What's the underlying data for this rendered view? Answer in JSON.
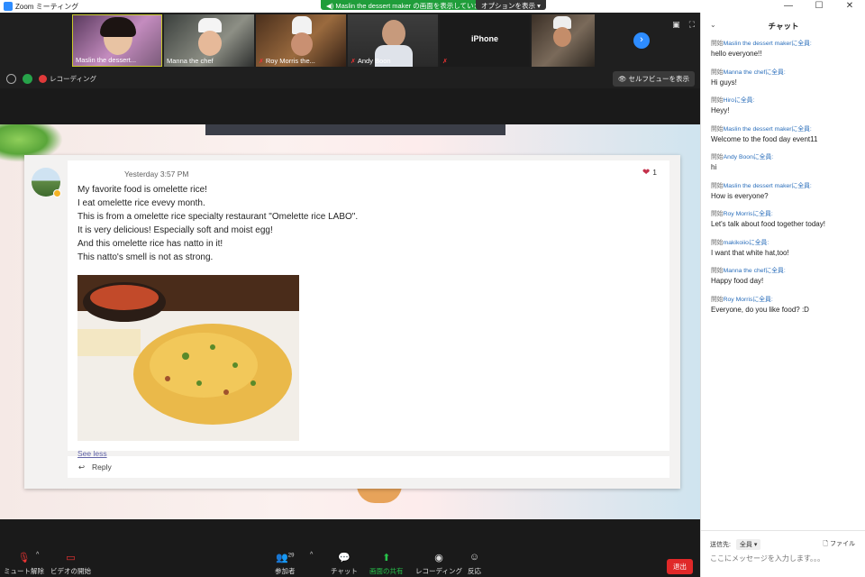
{
  "window": {
    "title": "Zoom ミーティング",
    "share_banner": "Maslin the dessert maker の画面を表示しています",
    "options_button": "オプションを表示 ▾",
    "controls": [
      "—",
      "☐",
      "✕"
    ]
  },
  "participants": [
    {
      "name": "Maslin the dessert..."
    },
    {
      "name": "Manna the chef"
    },
    {
      "name": "Roy Morris the..."
    },
    {
      "name": "Andy Boon"
    },
    {
      "name": "",
      "label": "iPhone"
    },
    {
      "name": ""
    }
  ],
  "status": {
    "recording_label": "レコーディング",
    "self_view_button": "セルフビューを表示"
  },
  "post": {
    "timestamp": "Yesterday 3:57 PM",
    "reaction_count": "1",
    "lines": [
      "My favorite food is omelette rice!",
      "I eat omelette rice evevy month.",
      "This is from a omelette rice specialty restaurant \"Omelette rice LABO\".",
      "It is very delicious! Especially soft and moist egg!",
      "And this omelette rice has natto in it!",
      "This natto's smell is not as strong."
    ],
    "see_less": "See less",
    "reply": "Reply"
  },
  "toolbar": {
    "mute": "ミュート解除",
    "video": "ビデオの開始",
    "participants": "参加者",
    "participants_count": "29",
    "chat": "チャット",
    "share": "画面の共有",
    "record": "レコーディング",
    "reactions": "反応",
    "leave": "退出"
  },
  "chat": {
    "title": "チャット",
    "messages": [
      {
        "prefix": "開始",
        "from": "Maslin the dessert maker",
        "suffix": "に全員:",
        "text": "hello everyone!!"
      },
      {
        "prefix": "開始",
        "from": "Manna the chef",
        "suffix": "に全員:",
        "text": "Hi guys!"
      },
      {
        "prefix": "開始",
        "from": "Hiro",
        "suffix": "に全員:",
        "text": "Heyy!"
      },
      {
        "prefix": "開始",
        "from": "Maslin the dessert maker",
        "suffix": "に全員:",
        "text": "Welcome to the food day event11"
      },
      {
        "prefix": "開始",
        "from": "Andy Boon",
        "suffix": "に全員:",
        "text": "hi"
      },
      {
        "prefix": "開始",
        "from": "Maslin the dessert maker",
        "suffix": "に全員:",
        "text": "How is everyone?"
      },
      {
        "prefix": "開始",
        "from": "Roy Morris",
        "suffix": "に全員:",
        "text": "Let's talk about food together today!"
      },
      {
        "prefix": "開始",
        "from": "makikoiio",
        "suffix": "に全員:",
        "text": "I want that white hat,too!"
      },
      {
        "prefix": "開始",
        "from": "Manna the chef",
        "suffix": "に全員:",
        "text": "Happy food day!"
      },
      {
        "prefix": "開始",
        "from": "Roy Morris",
        "suffix": "に全員:",
        "text": "Everyone, do you like food? :D"
      }
    ],
    "send_to_label": "送信先:",
    "send_to_value": "全員 ▾",
    "file_button": "ファイル",
    "input_placeholder": "ここにメッセージを入力します。。。"
  },
  "colors": {
    "zoom_blue": "#2d8cff",
    "share_green": "#1f9d3a",
    "leave_red": "#e02828",
    "heart_red": "#c4314b"
  }
}
